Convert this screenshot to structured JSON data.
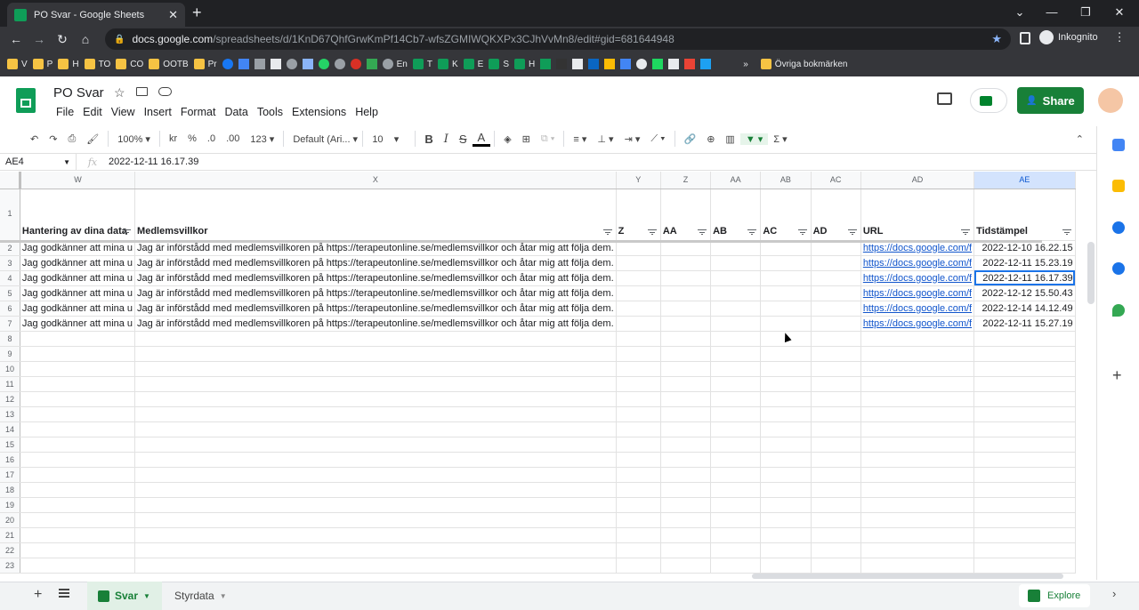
{
  "browser": {
    "tab_title": "PO Svar - Google Sheets",
    "url_host": "docs.google.com",
    "url_path": "/spreadsheets/d/1KnD67QhfGrwKmPf14Cb7-wfsZGMIWQKXPx3CJhVvMn8/edit#gid=681644948",
    "incognito_label": "Inkognito",
    "bookmarks": [
      {
        "label": "V",
        "color": "#f6c343"
      },
      {
        "label": "P",
        "color": "#f6c343"
      },
      {
        "label": "H",
        "color": "#f6c343"
      },
      {
        "label": "TO",
        "color": "#f6c343"
      },
      {
        "label": "CO",
        "color": "#f6c343"
      },
      {
        "label": "OOTB",
        "color": "#f6c343"
      },
      {
        "label": "Pr",
        "color": "#f6c343"
      },
      {
        "label": "En",
        "color": "#8ab4f8"
      },
      {
        "label": "T",
        "color": "#0f9d58"
      },
      {
        "label": "K",
        "color": "#0f9d58"
      },
      {
        "label": "E",
        "color": "#0f9d58"
      },
      {
        "label": "S",
        "color": "#0f9d58"
      },
      {
        "label": "H",
        "color": "#0f9d58"
      }
    ],
    "other_bookmarks": "Övriga bokmärken"
  },
  "doc": {
    "title": "PO Svar",
    "menus": [
      "File",
      "Edit",
      "View",
      "Insert",
      "Format",
      "Data",
      "Tools",
      "Extensions",
      "Help"
    ],
    "share_label": "Share"
  },
  "toolbar": {
    "zoom": "100%",
    "currency": "kr",
    "percent": "%",
    "dec_less": ".0",
    "dec_more": ".00",
    "more_formats": "123",
    "font": "Default (Ari...",
    "font_size": "10"
  },
  "formula": {
    "cell_ref": "AE4",
    "fx": "fx",
    "value": "2022-12-11 16.17.39"
  },
  "grid": {
    "columns": [
      "W",
      "X",
      "Y",
      "Z",
      "AA",
      "AB",
      "AC",
      "AD",
      "AE"
    ],
    "headers": [
      "Hantering av dina data",
      "Medlemsvillkor",
      "Z",
      "AA",
      "AB",
      "AC",
      "AD",
      "URL",
      "Tidstämpel"
    ],
    "rows": [
      {
        "n": "2",
        "w": "Jag godkänner att mina u",
        "x": "Jag är införstådd med medlemsvillkoren på https://terapeutonline.se/medlemsvillkor och åtar mig att följa dem.",
        "url": "https://docs.google.com/f",
        "ts": "2022-12-10 16.22.15"
      },
      {
        "n": "3",
        "w": "Jag godkänner att mina u",
        "x": "Jag är införstådd med medlemsvillkoren på https://terapeutonline.se/medlemsvillkor och åtar mig att följa dem.",
        "url": "https://docs.google.com/f",
        "ts": "2022-12-11 15.23.19"
      },
      {
        "n": "4",
        "w": "Jag godkänner att mina u",
        "x": "Jag är införstådd med medlemsvillkoren på https://terapeutonline.se/medlemsvillkor och åtar mig att följa dem.",
        "url": "https://docs.google.com/f",
        "ts": "2022-12-11 16.17.39"
      },
      {
        "n": "5",
        "w": "Jag godkänner att mina u",
        "x": "Jag är införstådd med medlemsvillkoren på https://terapeutonline.se/medlemsvillkor och åtar mig att följa dem.",
        "url": "https://docs.google.com/f",
        "ts": "2022-12-12 15.50.43"
      },
      {
        "n": "6",
        "w": "Jag godkänner att mina u",
        "x": "Jag är införstådd med medlemsvillkoren på https://terapeutonline.se/medlemsvillkor och åtar mig att följa dem.",
        "url": "https://docs.google.com/f",
        "ts": "2022-12-14 14.12.49"
      },
      {
        "n": "7",
        "w": "Jag godkänner att mina u",
        "x": "Jag är införstådd med medlemsvillkoren på https://terapeutonline.se/medlemsvillkor och åtar mig att följa dem.",
        "url": "https://docs.google.com/f",
        "ts": "2022-12-11 15.27.19"
      }
    ],
    "empty_rows": [
      "8",
      "9",
      "10",
      "11",
      "12",
      "13",
      "14",
      "15",
      "16",
      "17",
      "18",
      "19",
      "20",
      "21",
      "22",
      "23"
    ],
    "header_row_num": "1"
  },
  "sheets": {
    "tabs": [
      "Svar",
      "Styrdata"
    ],
    "explore_label": "Explore"
  }
}
